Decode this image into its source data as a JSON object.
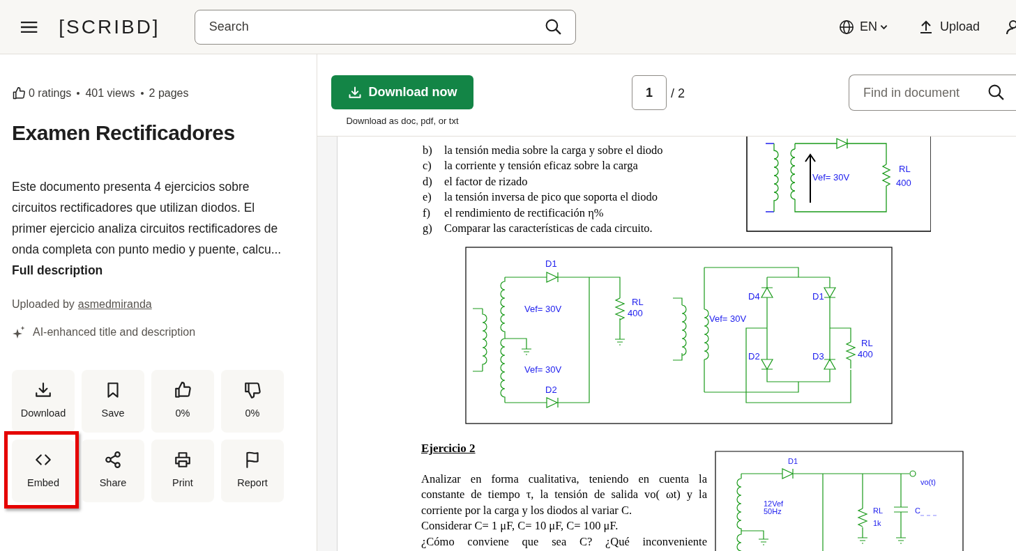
{
  "header": {
    "logo": "[SCRIBD]",
    "search": {
      "placeholder": "Search"
    },
    "language": "EN",
    "upload": "Upload"
  },
  "sidebar": {
    "stats": [
      "0 ratings",
      "401 views",
      "2 pages"
    ],
    "title": "Examen Rectificadores",
    "description": "Este documento presenta 4 ejercicios sobre circuitos rectificadores que utilizan diodos. El primer ejercicio analiza circuitos rectificadores de onda completa con punto medio y puente, calcu...",
    "description_link": "Full description",
    "uploaded_by": "Uploaded by",
    "uploader": "asmedmiranda",
    "ai_note": "AI-enhanced title and description",
    "actions": [
      {
        "kind": "download",
        "label": "Download",
        "highlighted": false
      },
      {
        "kind": "save",
        "label": "Save",
        "highlighted": false
      },
      {
        "kind": "like",
        "label": "0%",
        "highlighted": false
      },
      {
        "kind": "dislike",
        "label": "0%",
        "highlighted": false
      },
      {
        "kind": "embed",
        "label": "Embed",
        "highlighted": true
      },
      {
        "kind": "share",
        "label": "Share",
        "highlighted": false
      },
      {
        "kind": "print",
        "label": "Print",
        "highlighted": false
      },
      {
        "kind": "report",
        "label": "Report",
        "highlighted": false
      }
    ]
  },
  "toolbar": {
    "download_button": "Download now",
    "download_note": "Download as doc, pdf, or txt",
    "page": "1",
    "page_total": "/ 2",
    "find": {
      "placeholder": "Find in document"
    }
  },
  "document": {
    "list": [
      {
        "marker": "b)",
        "text": "la tensión media sobre la carga y sobre el diodo"
      },
      {
        "marker": "c)",
        "text": "la corriente y tensión eficaz sobre la carga"
      },
      {
        "marker": "d)",
        "text": "el factor de rizado"
      },
      {
        "marker": "e)",
        "text": "la tensión inversa de pico que soporta el diodo"
      },
      {
        "marker": "f)",
        "text": "el rendimiento de rectificación η%"
      },
      {
        "marker": "g)",
        "text": "Comparar las características de cada circuito."
      }
    ],
    "diagrams": [
      {
        "labels": [
          "Vef= 30V",
          "RL",
          "400"
        ]
      },
      {
        "labels": [
          "D1",
          "Vef= 30V",
          "RL",
          "400",
          "Vef= 30V",
          "D2",
          "D4",
          "D1",
          "Vef= 30V",
          "D2",
          "D3",
          "RL",
          "400"
        ]
      },
      {
        "labels": [
          "D1",
          "12Vef",
          "50Hz",
          "RL",
          "1k",
          "C",
          "vo(t)"
        ]
      }
    ],
    "heading": "Ejercicio 2",
    "paragraph_lines": [
      {
        "text": "Analizar en forma cualitativa, teniendo en cuenta la",
        "justified": true
      },
      {
        "text": "constante de tiempo τ, la tensión de salida vo( ωt) y la",
        "justified": true
      },
      {
        "text": "corriente por la carga y los diodos al variar C.",
        "justified": false
      },
      {
        "text": "Considerar C= 1 μF, C= 10 μF, C= 100 μF.",
        "justified": false
      },
      {
        "text": "¿Cómo conviene que sea C? ¿Qué inconveniente",
        "justified": true
      }
    ]
  }
}
